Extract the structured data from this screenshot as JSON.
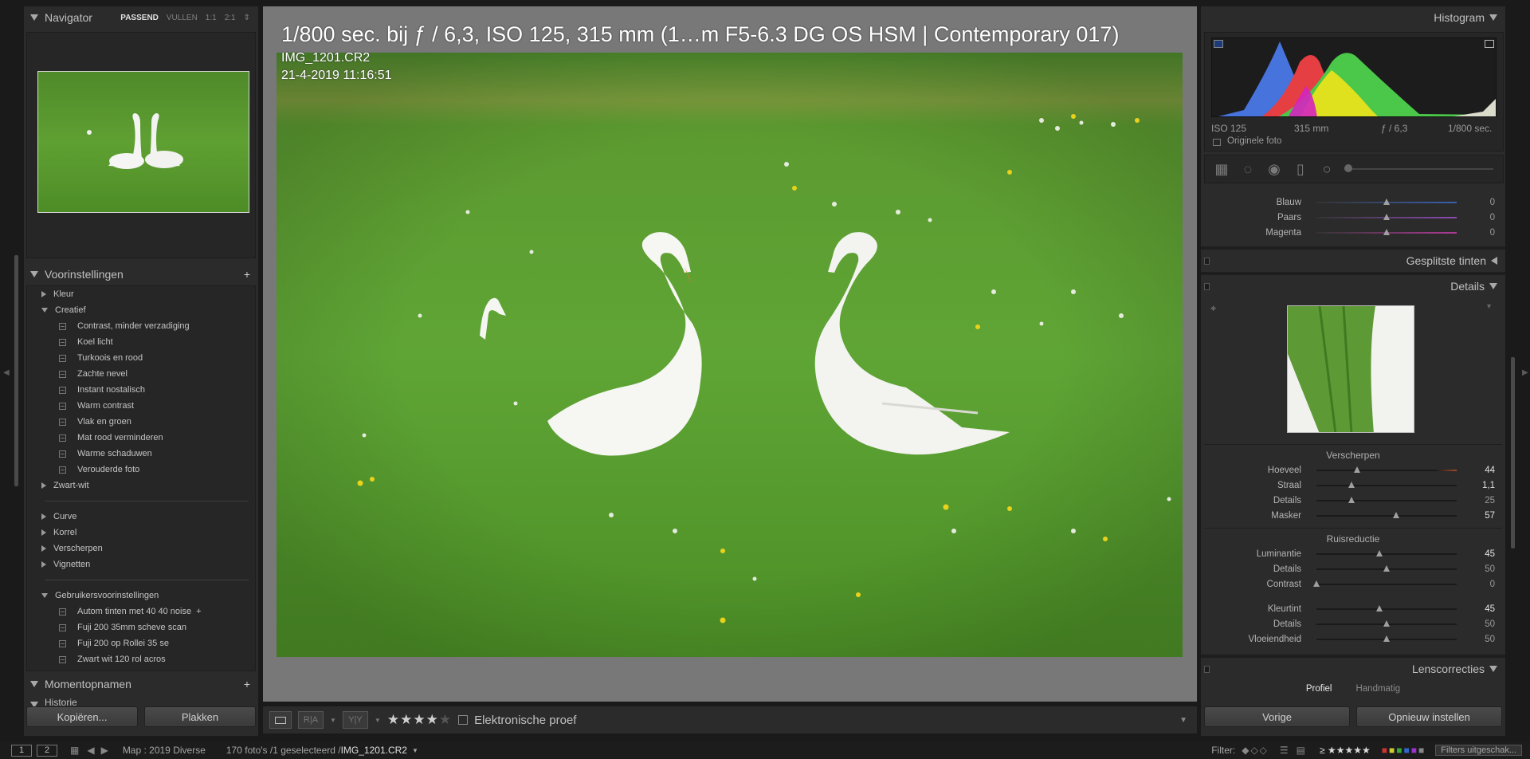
{
  "navigator": {
    "title": "Navigator",
    "zoom_options": [
      "PASSEND",
      "VULLEN",
      "1:1",
      "2:1"
    ]
  },
  "presets": {
    "title": "Voorinstellingen",
    "add": "+",
    "groups": [
      {
        "label": "Kleur"
      },
      {
        "label": "Creatief"
      },
      {
        "label": "Zwart-wit"
      },
      {
        "label": "Curve"
      },
      {
        "label": "Korrel"
      },
      {
        "label": "Verscherpen"
      },
      {
        "label": "Vignetten"
      },
      {
        "label": "Gebruikersvoorinstellingen"
      }
    ],
    "creatief_items": [
      "Contrast, minder verzadiging",
      "Koel licht",
      "Turkoois en rood",
      "Zachte nevel",
      "Instant nostalisch",
      "Warm contrast",
      "Vlak en groen",
      "Mat rood verminderen",
      "Warme schaduwen",
      "Verouderde foto"
    ],
    "user_items": [
      "Autom tinten met 40 40 noise",
      "Fuji 200 35mm scheve scan",
      "Fuji 200 op Rollei 35 se",
      "Zwart wit 120 rol acros"
    ],
    "user_first_suffix": "+"
  },
  "snapshots": {
    "title": "Momentopnamen",
    "add": "+"
  },
  "history": {
    "title": "Historie"
  },
  "left_buttons": {
    "copy": "Kopiëren...",
    "paste": "Plakken"
  },
  "photo_info": {
    "title": "1/800 sec. bij ƒ / 6,3, ISO 125, 315 mm (1…m F5-6.3 DG OS HSM | Contemporary 017)",
    "filename": "IMG_1201.CR2",
    "datetime": "21-4-2019 11:16:51"
  },
  "toolbar": {
    "compare_label": "R|A",
    "survey_label": "Y|Y",
    "rating_filled": "★★★★",
    "rating_empty": "★",
    "proof_label": "Elektronische proef"
  },
  "histogram": {
    "title": "Histogram",
    "iso": "ISO 125",
    "focal": "315 mm",
    "aperture": "ƒ / 6,3",
    "shutter": "1/800 sec.",
    "original_label": "Originele foto"
  },
  "hsl": {
    "rows": [
      {
        "label": "Blauw",
        "value": "0",
        "pos": 0.5
      },
      {
        "label": "Paars",
        "value": "0",
        "pos": 0.5
      },
      {
        "label": "Magenta",
        "value": "0",
        "pos": 0.5
      }
    ]
  },
  "split_toning": {
    "title": "Gesplitste tinten"
  },
  "details": {
    "title": "Details",
    "sharpen_title": "Verscherpen",
    "sharpen": [
      {
        "label": "Hoeveel",
        "value": "44",
        "pos": 0.29,
        "hi": true
      },
      {
        "label": "Straal",
        "value": "1,1",
        "pos": 0.25,
        "hi": true
      },
      {
        "label": "Details",
        "value": "25",
        "pos": 0.25,
        "hi": false
      },
      {
        "label": "Masker",
        "value": "57",
        "pos": 0.57,
        "hi": true
      }
    ],
    "noise_title": "Ruisreductie",
    "noise": [
      {
        "label": "Luminantie",
        "value": "45",
        "pos": 0.45,
        "hi": true
      },
      {
        "label": "Details",
        "value": "50",
        "pos": 0.5,
        "hi": false
      },
      {
        "label": "Contrast",
        "value": "0",
        "pos": 0.0,
        "hi": false
      }
    ],
    "color_noise": [
      {
        "label": "Kleurtint",
        "value": "45",
        "pos": 0.45,
        "hi": true
      },
      {
        "label": "Details",
        "value": "50",
        "pos": 0.5,
        "hi": false
      },
      {
        "label": "Vloeiendheid",
        "value": "50",
        "pos": 0.5,
        "hi": false
      }
    ]
  },
  "lens": {
    "title": "Lenscorrecties",
    "tabs": [
      "Profiel",
      "Handmatig"
    ]
  },
  "right_buttons": {
    "prev": "Vorige",
    "reset": "Opnieuw instellen"
  },
  "filmstrip": {
    "screen1": "1",
    "screen2": "2",
    "source": "Map : 2019 Diverse",
    "count": "170 foto's /1 geselecteerd /",
    "current_file": "IMG_1201.CR2",
    "filter_label": "Filter:",
    "filter_state": "Filters uitgeschak..."
  }
}
